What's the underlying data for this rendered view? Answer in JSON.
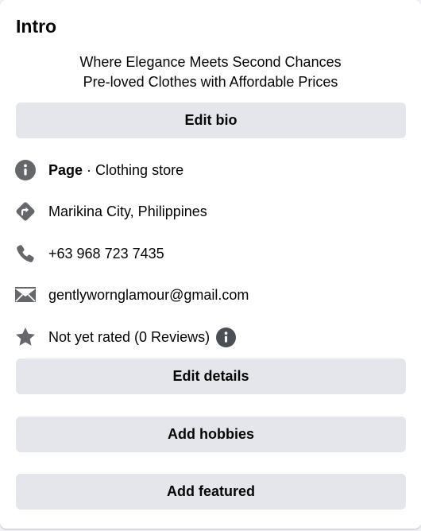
{
  "intro": {
    "title": "Intro",
    "bio_line1": "Where Elegance Meets Second Chances",
    "bio_line2": "Pre-loved Clothes with Affordable Prices",
    "edit_bio_label": "Edit bio"
  },
  "details": {
    "category_prefix": "Page",
    "category_suffix": " · Clothing store",
    "location": "Marikina City, Philippines",
    "phone": "+63 968 723 7435",
    "email": "gentlywornglamour@gmail.com",
    "rating": "Not yet rated (0 Reviews)",
    "icons": [
      "info-icon",
      "directions-icon",
      "phone-icon",
      "mail-icon",
      "star-icon",
      "info-icon"
    ]
  },
  "buttons": {
    "edit_details": "Edit details",
    "add_hobbies": "Add hobbies",
    "add_featured": "Add featured"
  },
  "colors": {
    "icon": "#65676b",
    "button_bg": "#e4e6eb",
    "text": "#050505"
  }
}
